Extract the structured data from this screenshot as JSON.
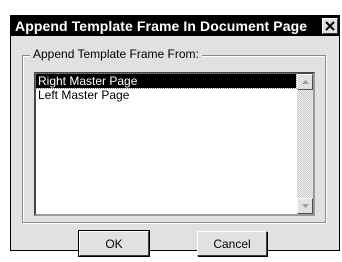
{
  "dialog": {
    "title": "Append Template Frame In Document Page",
    "close_icon": "close-icon"
  },
  "group": {
    "label": "Append Template Frame From:"
  },
  "list": {
    "items": [
      "Right Master Page",
      "Left Master Page"
    ],
    "selected": "Right Master Page",
    "scroll_up_icon": "scroll-up-arrow-icon",
    "scroll_down_icon": "scroll-down-arrow-icon"
  },
  "buttons": {
    "ok": "OK",
    "cancel": "Cancel"
  }
}
